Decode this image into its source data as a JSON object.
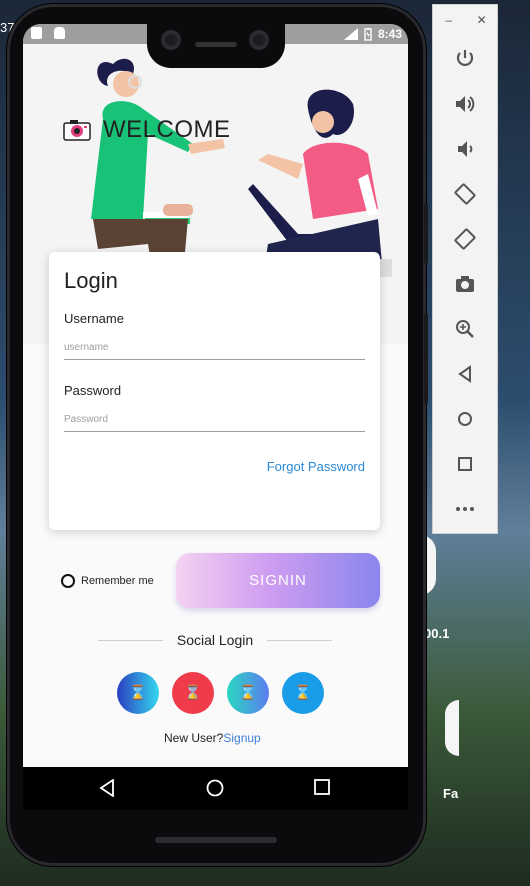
{
  "status_bar": {
    "time": "8:43"
  },
  "hero": {
    "welcome_text": "WELCOME"
  },
  "login_card": {
    "title": "Login",
    "username_label": "Username",
    "username_placeholder": "username",
    "password_label": "Password",
    "password_placeholder": "Password",
    "forgot_password": "Forgot Password"
  },
  "remember_me": "Remember me",
  "signin_button": "SIGNIN",
  "social": {
    "title": "Social Login",
    "buttons": [
      {
        "name": "social-button-1",
        "glyph": "⌛",
        "colors": [
          "#2a3fbf",
          "#35d8f0"
        ]
      },
      {
        "name": "social-button-2",
        "glyph": "⌛",
        "colors": [
          "#ef3b4a",
          "#ef3b4a"
        ]
      },
      {
        "name": "social-button-3",
        "glyph": "⌛",
        "colors": [
          "#2ad6c2",
          "#5b7df0"
        ]
      },
      {
        "name": "social-button-4",
        "glyph": "⌛",
        "colors": [
          "#1a9de8",
          "#1a9de8"
        ]
      }
    ]
  },
  "new_user": {
    "text": "New User?",
    "link": "Signup"
  },
  "desktop": {
    "cut_text": "37",
    "value_text": "00.1",
    "fa_text": "Fa"
  },
  "colors": {
    "accent_blue": "#2a8ad8",
    "signin_gradient": [
      "#f4d2f0",
      "#cf9df0",
      "#8a86ee"
    ]
  },
  "emulator_panel": {
    "icons": [
      "power-icon",
      "volume-up-icon",
      "volume-down-icon",
      "rotate-left-icon",
      "rotate-right-icon",
      "camera-icon",
      "zoom-icon",
      "back-icon",
      "home-icon",
      "overview-icon",
      "more-icon"
    ]
  }
}
